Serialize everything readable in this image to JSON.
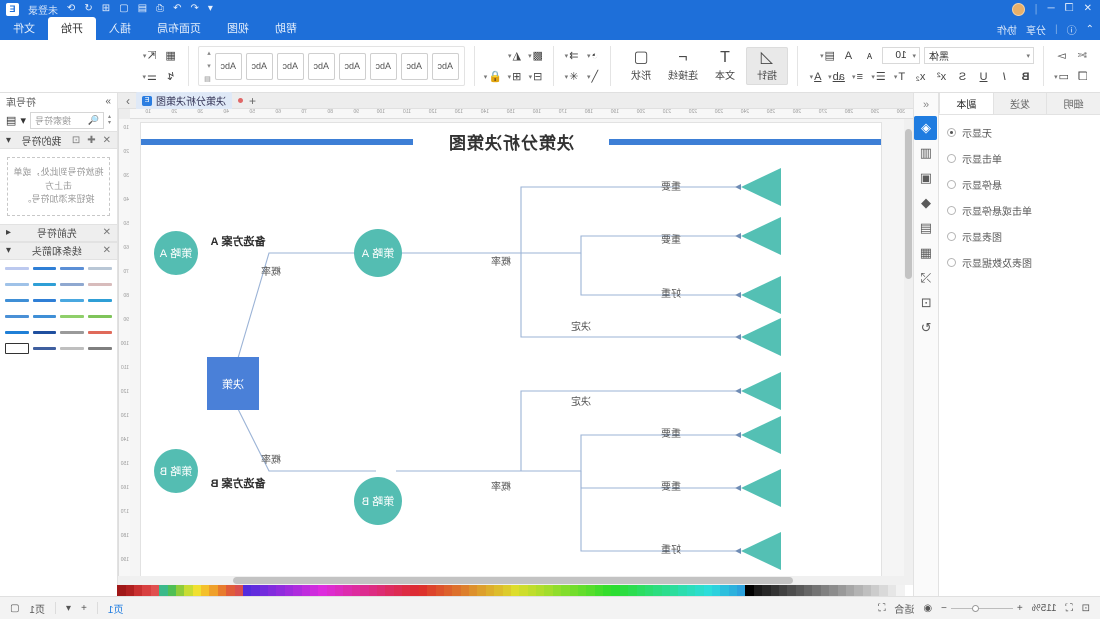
{
  "app": {
    "brand_badge": "E",
    "title_icons": [
      "close-icon",
      "restore-icon",
      "minimize-icon",
      "account-avatar"
    ],
    "account_label": "未登录",
    "quick_access": [
      "自动保存",
      "撤销",
      "重做",
      "打印",
      "保存",
      "新建",
      "打开",
      "更多"
    ],
    "quick_items_left": [
      "分享",
      "协作"
    ]
  },
  "tabs": [
    {
      "label": "文件",
      "active": false
    },
    {
      "label": "开始",
      "active": true
    },
    {
      "label": "插入",
      "active": false
    },
    {
      "label": "页面布局",
      "active": false
    },
    {
      "label": "视图",
      "active": false
    },
    {
      "label": "帮助",
      "active": false
    }
  ],
  "ribbon": {
    "groups": [
      {
        "name": "clipboard",
        "rows": [
          [
            "粘贴",
            "剪切"
          ],
          [
            "复制",
            "格式刷"
          ]
        ],
        "icons_row1": [
          "paste-icon",
          "cut-icon"
        ],
        "icons_row2": [
          "copy-icon",
          "format-painter-icon"
        ]
      },
      {
        "name": "arrange",
        "icons_row1": [
          "align-icon",
          "group-icon"
        ],
        "icons_row2": [
          "distribute-icon",
          "rotate-icon"
        ]
      },
      {
        "name": "styles",
        "gallery_label": "Abc",
        "gallery_count": 8,
        "side_marks": [
          "▴",
          "▾",
          "▤"
        ]
      },
      {
        "name": "flip-lock",
        "icons_row1": [
          "flip-icon",
          "layer-icon"
        ],
        "icons_row2": [
          "lock-icon",
          "line-icon"
        ]
      },
      {
        "name": "line-fill",
        "icons_row1": [
          "line-style-icon",
          "fill-icon"
        ],
        "icons_row2": [
          "effect-icon",
          "pen-icon"
        ]
      },
      {
        "name": "insert-tools",
        "buttons": [
          {
            "label": "形状",
            "icon": "shape-icon",
            "selected": false
          },
          {
            "label": "连接线",
            "icon": "connector-icon",
            "selected": false
          },
          {
            "label": "文本",
            "icon": "text-icon",
            "selected": false
          },
          {
            "label": "指针",
            "icon": "pointer-icon",
            "selected": true
          }
        ]
      },
      {
        "name": "font",
        "font_name": "黑体",
        "font_size": "10",
        "icons_row1": [
          "align-text-icon",
          "grow-font-icon",
          "shrink-font-icon"
        ],
        "icons_row2": [
          "font-color-icon",
          "highlight-icon",
          "bullets-icon",
          "numbering-icon",
          "clear-format-icon",
          "subscript-icon",
          "superscript-icon",
          "strikethrough-icon",
          "underline-icon",
          "italic-icon",
          "bold-icon"
        ]
      },
      {
        "name": "edit",
        "icons_row1": [
          "select-icon",
          "cut-scissors-icon"
        ],
        "icons_row2": [
          "paste-small-icon",
          "copy-small-icon"
        ]
      }
    ]
  },
  "left_panel": {
    "tabs": [
      {
        "label": "副本",
        "active": true
      },
      {
        "label": "发送",
        "active": false
      },
      {
        "label": "细明",
        "active": false
      }
    ],
    "options": [
      {
        "label": "无显示",
        "selected": true
      },
      {
        "label": "单击显示",
        "selected": false
      },
      {
        "label": "悬停显示",
        "selected": false
      },
      {
        "label": "单击或悬停显示",
        "selected": false
      },
      {
        "label": "图表显示",
        "selected": false
      },
      {
        "label": "图表及数据显示",
        "selected": false
      }
    ],
    "strip_icons": [
      {
        "name": "fill-bucket-icon",
        "glyph": "◈",
        "active": true
      },
      {
        "name": "grid-icon",
        "glyph": "▥",
        "active": false
      },
      {
        "name": "image-icon",
        "glyph": "▣",
        "active": false
      },
      {
        "name": "layers-icon",
        "glyph": "◆",
        "active": false
      },
      {
        "name": "note-icon",
        "glyph": "▤",
        "active": false
      },
      {
        "name": "chart-icon",
        "glyph": "▦",
        "active": false
      },
      {
        "name": "shuffle-icon",
        "glyph": "⤭",
        "active": false
      },
      {
        "name": "stamp-icon",
        "glyph": "⊡",
        "active": false
      },
      {
        "name": "refresh-icon",
        "glyph": "↻",
        "active": false
      }
    ],
    "collapse_glyph": "«"
  },
  "doc_tabs": {
    "tab_label": "决策分析决策图",
    "tab_icon": "E",
    "modified_dot": true,
    "add_label": "+"
  },
  "canvas": {
    "title": "决策分析决策图",
    "ruler_h_labels": [
      "300",
      "290",
      "280",
      "270",
      "260",
      "250",
      "240",
      "230",
      "220",
      "210",
      "200",
      "190",
      "180",
      "170",
      "160",
      "150",
      "140",
      "130",
      "120",
      "110",
      "100",
      "90",
      "80",
      "70",
      "60",
      "50",
      "40",
      "30",
      "20",
      "10"
    ],
    "ruler_v_labels": [
      "10",
      "20",
      "30",
      "40",
      "50",
      "60",
      "70",
      "80",
      "90",
      "100",
      "110",
      "120",
      "130",
      "140",
      "150",
      "160",
      "170",
      "180",
      "190",
      "200",
      "210"
    ]
  },
  "chart_data": {
    "type": "diagram",
    "diagram_kind": "decision-tree",
    "title": "决策分析决策图",
    "root": {
      "label": "决策",
      "shape": "rect",
      "color": "#4a7fd4"
    },
    "branches": [
      {
        "node_label": "策略 A",
        "alt_label": "备选方案 A",
        "edge_label": "概率",
        "node_color": "#5bbdb2",
        "sub_node_label": "策略 A",
        "leaves": [
          {
            "label": "重要",
            "shape": "triangle"
          },
          {
            "label": "重要",
            "shape": "triangle"
          },
          {
            "label": "好重",
            "shape": "triangle"
          },
          {
            "label": "决定",
            "shape": "triangle"
          }
        ]
      },
      {
        "node_label": "策略 B",
        "alt_label": "备选方案 B",
        "edge_label": "概率",
        "node_color": "#5bbdb2",
        "sub_node_label": "策略 B",
        "leaves": [
          {
            "label": "决定",
            "shape": "triangle"
          },
          {
            "label": "重要",
            "shape": "triangle"
          },
          {
            "label": "重要",
            "shape": "triangle"
          },
          {
            "label": "好重",
            "shape": "triangle"
          }
        ]
      }
    ],
    "colors": {
      "node": "#5bbdb2",
      "root": "#4a7fd4",
      "connector": "#9bb3d6",
      "leaf": "#5bbdb2"
    }
  },
  "right_panel": {
    "collapse_glyph": "»",
    "header_title": "符号库",
    "search_placeholder": "搜索符号",
    "search_icon": "search-icon",
    "sections": [
      {
        "title": "我的符号",
        "actions": [
          "add-icon",
          "import-icon",
          "close-icon"
        ],
        "dropzone_line1": "拖放符号到此处，或单击上方",
        "dropzone_line2": "按钮来添加符号。"
      },
      {
        "title": "先前符号",
        "actions": [
          "close-icon"
        ]
      },
      {
        "title": "线条和箭头",
        "actions": [
          "close-icon"
        ]
      }
    ],
    "symbol_rows": 6,
    "symbol_cols": 4,
    "symbol_colors": [
      [
        "#b9c7d6",
        "#5b8fd6",
        "#2f7fd6",
        "#bcc9ef"
      ],
      [
        "#d8bcbc",
        "#8fa8d0",
        "#2f9fd6",
        "#9fc2e8"
      ],
      [
        "#2f9fd6",
        "#4aa8e0",
        "#2f7fd6",
        "#3f8fd6"
      ],
      [
        "#7fc45a",
        "#8fcf6a",
        "#3f8fd6",
        "#4a90d6"
      ],
      [
        "#e06a5a",
        "#9a9a9a",
        "#1f4f9f",
        "#1f7fd6"
      ],
      [
        "#7f7f7f",
        "#bfbfbf",
        "#3f5f9f",
        "#ffffff"
      ]
    ]
  },
  "status_bar": {
    "left_icons": [
      "fit-page-icon",
      "fit-width-icon"
    ],
    "zoom_level": "115%",
    "zoom_minus": "−",
    "zoom_plus": "+",
    "fit_label": "适合",
    "right_page_label": "页1",
    "page_add": "+",
    "page_menu": "▾",
    "view_icon": "view-mode-icon",
    "fullscreen_icon": "fullscreen-icon",
    "presentation_icon": "presentation-icon"
  }
}
